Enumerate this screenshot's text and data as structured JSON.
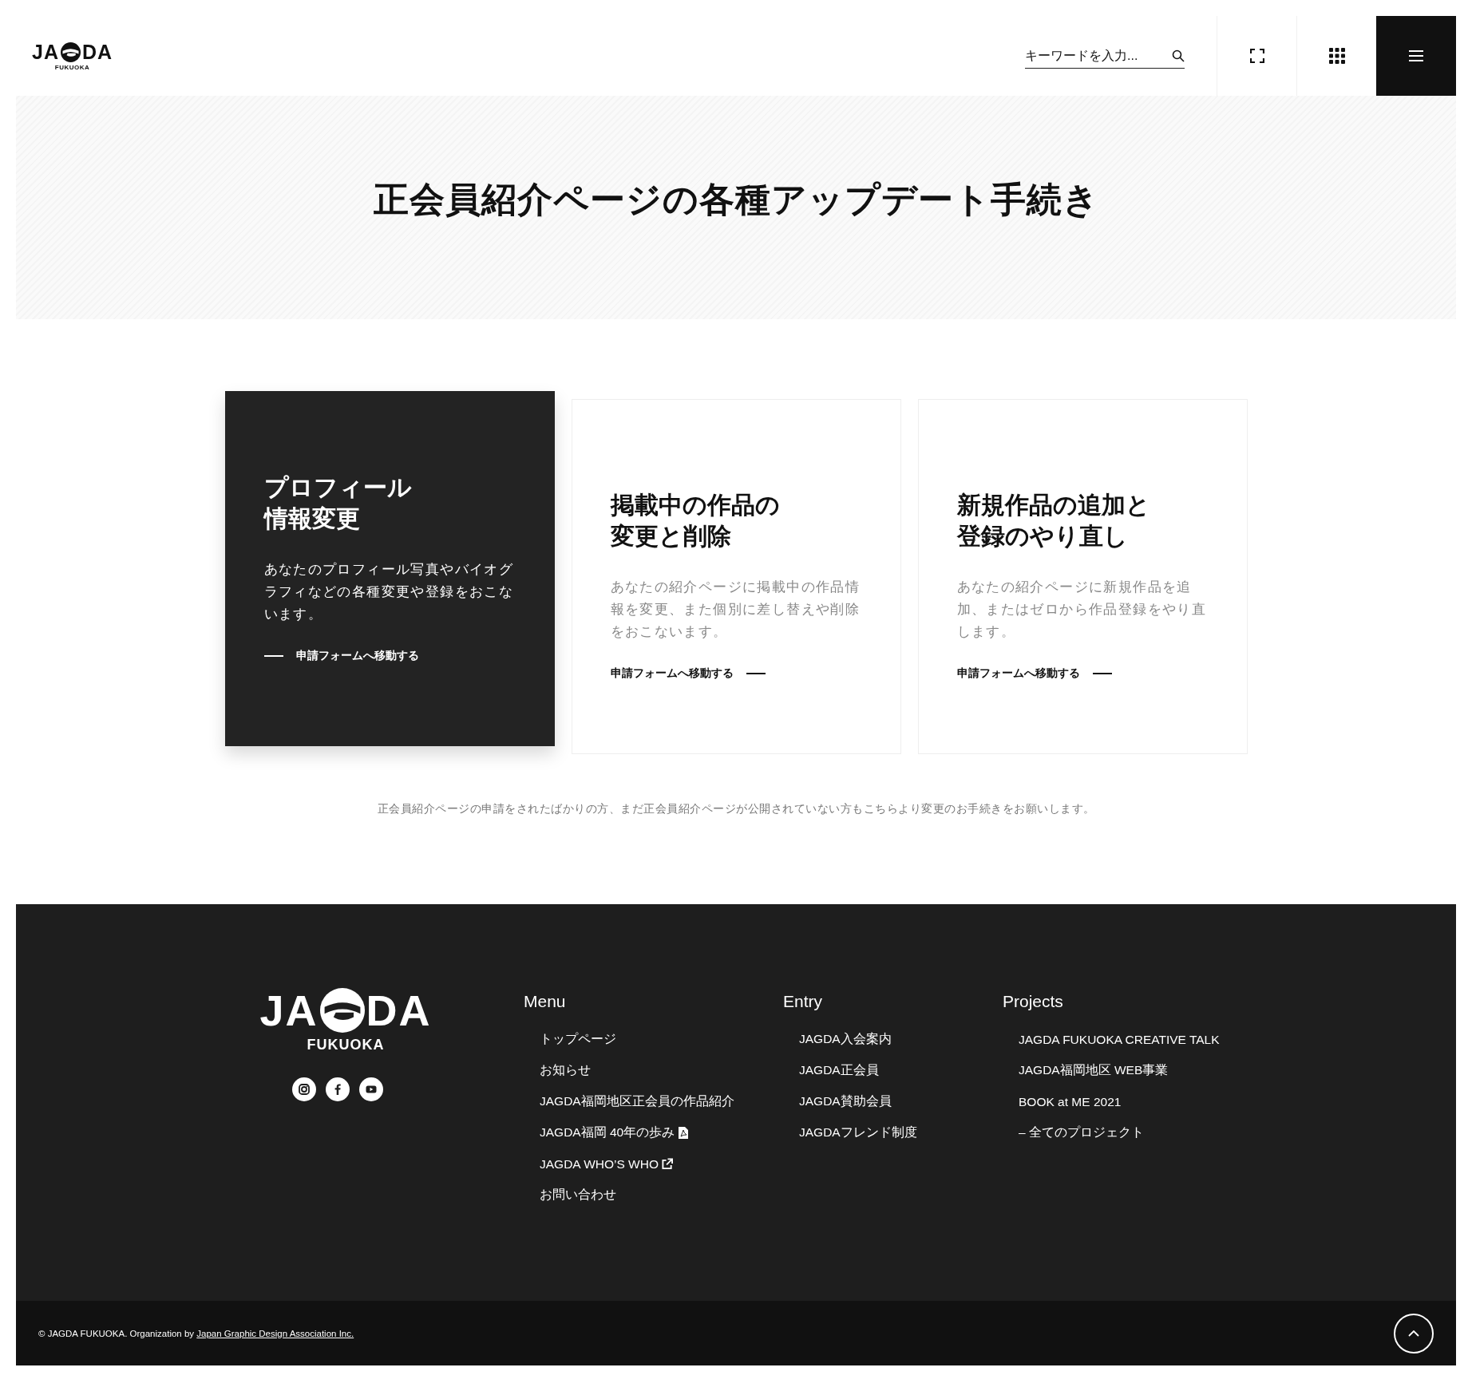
{
  "header": {
    "logo": {
      "left": "JA",
      "right": "DA",
      "subtitle": "FUKUOKA"
    },
    "search": {
      "placeholder": "キーワードを入力..."
    }
  },
  "hero": {
    "title": "正会員紹介ページの各種アップデート手続き"
  },
  "cards": [
    {
      "title_lines": [
        "プロフィール",
        "情報変更"
      ],
      "description": "あなたのプロフィール写真やバイオグラフィなどの各種変更や登録をおこないます。",
      "link": "申請フォームへ移動する",
      "highlighted": true
    },
    {
      "title_lines": [
        "掲載中の作品の",
        "変更と削除"
      ],
      "description": "あなたの紹介ページに掲載中の作品情報を変更、また個別に差し替えや削除をおこないます。",
      "link": "申請フォームへ移動する",
      "highlighted": false
    },
    {
      "title_lines": [
        "新規作品の追加と",
        "登録のやり直し"
      ],
      "description": "あなたの紹介ページに新規作品を追加、またはゼロから作品登録をやり直します。",
      "link": "申請フォームへ移動する",
      "highlighted": false
    }
  ],
  "note": "正会員紹介ページの申請をされたばかりの方、まだ正会員紹介ページが公開されていない方もこちらより変更のお手続きをお願いします。",
  "footer": {
    "logo": {
      "left": "JA",
      "right": "DA",
      "subtitle": "FUKUOKA"
    },
    "social": [
      {
        "kind": "instagram"
      },
      {
        "kind": "facebook"
      },
      {
        "kind": "youtube"
      }
    ],
    "columns": [
      {
        "heading": "Menu",
        "links": [
          {
            "label": "トップページ"
          },
          {
            "label": "お知らせ"
          },
          {
            "label": "JAGDA福岡地区正会員の作品紹介"
          },
          {
            "label": "JAGDA福岡 40年の歩み",
            "kind": "pdf"
          },
          {
            "label": "JAGDA WHO’S WHO",
            "kind": "external"
          },
          {
            "label": "お問い合わせ"
          }
        ]
      },
      {
        "heading": "Entry",
        "links": [
          {
            "label": "JAGDA入会案内"
          },
          {
            "label": "JAGDA正会員"
          },
          {
            "label": "JAGDA賛助会員"
          },
          {
            "label": "JAGDAフレンド制度"
          }
        ]
      },
      {
        "heading": "Projects",
        "links": [
          {
            "label": "JAGDA FUKUOKA CREATIVE TALK"
          },
          {
            "label": "JAGDA福岡地区 WEB事業"
          },
          {
            "label": "BOOK at ME 2021"
          },
          {
            "label": "– 全てのプロジェクト"
          }
        ]
      }
    ],
    "copyright": {
      "text": "© JAGDA FUKUOKA. Organization by",
      "link": "Japan Graphic Design Association Inc."
    }
  }
}
